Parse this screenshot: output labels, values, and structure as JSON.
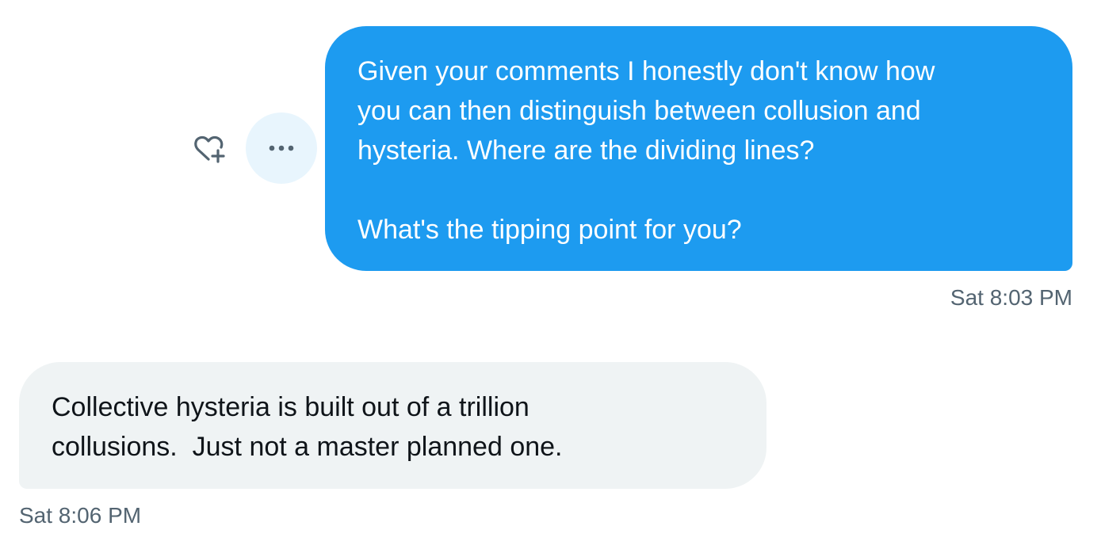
{
  "conversation": {
    "sent_message": {
      "lines": [
        "Given your comments I honestly don't know how",
        "you can then distinguish between collusion and",
        "hysteria. Where are the dividing lines?",
        "",
        "What's the tipping point for you?"
      ],
      "timestamp": "Sat 8:03 PM"
    },
    "received_message": {
      "lines": [
        "Collective hysteria is built out of a trillion",
        "collusions.  Just not a master planned one."
      ],
      "timestamp": "Sat 8:06 PM"
    }
  },
  "actions": {
    "react_icon": "heart-plus-icon",
    "more_icon": "more-horizontal-icon"
  },
  "colors": {
    "sent_bubble": "#1d9bf0",
    "received_bubble": "#eff3f4",
    "timestamp_text": "#536471",
    "more_button_bg": "#e8f5fd",
    "icon": "#536471"
  }
}
